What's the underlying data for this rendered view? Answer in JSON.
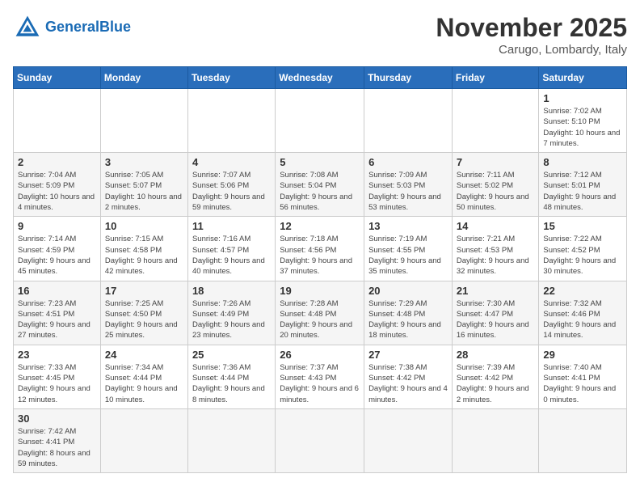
{
  "logo": {
    "text_general": "General",
    "text_blue": "Blue"
  },
  "title": "November 2025",
  "location": "Carugo, Lombardy, Italy",
  "weekdays": [
    "Sunday",
    "Monday",
    "Tuesday",
    "Wednesday",
    "Thursday",
    "Friday",
    "Saturday"
  ],
  "weeks": [
    [
      {
        "day": "",
        "info": ""
      },
      {
        "day": "",
        "info": ""
      },
      {
        "day": "",
        "info": ""
      },
      {
        "day": "",
        "info": ""
      },
      {
        "day": "",
        "info": ""
      },
      {
        "day": "",
        "info": ""
      },
      {
        "day": "1",
        "info": "Sunrise: 7:02 AM\nSunset: 5:10 PM\nDaylight: 10 hours and 7 minutes."
      }
    ],
    [
      {
        "day": "2",
        "info": "Sunrise: 7:04 AM\nSunset: 5:09 PM\nDaylight: 10 hours and 4 minutes."
      },
      {
        "day": "3",
        "info": "Sunrise: 7:05 AM\nSunset: 5:07 PM\nDaylight: 10 hours and 2 minutes."
      },
      {
        "day": "4",
        "info": "Sunrise: 7:07 AM\nSunset: 5:06 PM\nDaylight: 9 hours and 59 minutes."
      },
      {
        "day": "5",
        "info": "Sunrise: 7:08 AM\nSunset: 5:04 PM\nDaylight: 9 hours and 56 minutes."
      },
      {
        "day": "6",
        "info": "Sunrise: 7:09 AM\nSunset: 5:03 PM\nDaylight: 9 hours and 53 minutes."
      },
      {
        "day": "7",
        "info": "Sunrise: 7:11 AM\nSunset: 5:02 PM\nDaylight: 9 hours and 50 minutes."
      },
      {
        "day": "8",
        "info": "Sunrise: 7:12 AM\nSunset: 5:01 PM\nDaylight: 9 hours and 48 minutes."
      }
    ],
    [
      {
        "day": "9",
        "info": "Sunrise: 7:14 AM\nSunset: 4:59 PM\nDaylight: 9 hours and 45 minutes."
      },
      {
        "day": "10",
        "info": "Sunrise: 7:15 AM\nSunset: 4:58 PM\nDaylight: 9 hours and 42 minutes."
      },
      {
        "day": "11",
        "info": "Sunrise: 7:16 AM\nSunset: 4:57 PM\nDaylight: 9 hours and 40 minutes."
      },
      {
        "day": "12",
        "info": "Sunrise: 7:18 AM\nSunset: 4:56 PM\nDaylight: 9 hours and 37 minutes."
      },
      {
        "day": "13",
        "info": "Sunrise: 7:19 AM\nSunset: 4:55 PM\nDaylight: 9 hours and 35 minutes."
      },
      {
        "day": "14",
        "info": "Sunrise: 7:21 AM\nSunset: 4:53 PM\nDaylight: 9 hours and 32 minutes."
      },
      {
        "day": "15",
        "info": "Sunrise: 7:22 AM\nSunset: 4:52 PM\nDaylight: 9 hours and 30 minutes."
      }
    ],
    [
      {
        "day": "16",
        "info": "Sunrise: 7:23 AM\nSunset: 4:51 PM\nDaylight: 9 hours and 27 minutes."
      },
      {
        "day": "17",
        "info": "Sunrise: 7:25 AM\nSunset: 4:50 PM\nDaylight: 9 hours and 25 minutes."
      },
      {
        "day": "18",
        "info": "Sunrise: 7:26 AM\nSunset: 4:49 PM\nDaylight: 9 hours and 23 minutes."
      },
      {
        "day": "19",
        "info": "Sunrise: 7:28 AM\nSunset: 4:48 PM\nDaylight: 9 hours and 20 minutes."
      },
      {
        "day": "20",
        "info": "Sunrise: 7:29 AM\nSunset: 4:48 PM\nDaylight: 9 hours and 18 minutes."
      },
      {
        "day": "21",
        "info": "Sunrise: 7:30 AM\nSunset: 4:47 PM\nDaylight: 9 hours and 16 minutes."
      },
      {
        "day": "22",
        "info": "Sunrise: 7:32 AM\nSunset: 4:46 PM\nDaylight: 9 hours and 14 minutes."
      }
    ],
    [
      {
        "day": "23",
        "info": "Sunrise: 7:33 AM\nSunset: 4:45 PM\nDaylight: 9 hours and 12 minutes."
      },
      {
        "day": "24",
        "info": "Sunrise: 7:34 AM\nSunset: 4:44 PM\nDaylight: 9 hours and 10 minutes."
      },
      {
        "day": "25",
        "info": "Sunrise: 7:36 AM\nSunset: 4:44 PM\nDaylight: 9 hours and 8 minutes."
      },
      {
        "day": "26",
        "info": "Sunrise: 7:37 AM\nSunset: 4:43 PM\nDaylight: 9 hours and 6 minutes."
      },
      {
        "day": "27",
        "info": "Sunrise: 7:38 AM\nSunset: 4:42 PM\nDaylight: 9 hours and 4 minutes."
      },
      {
        "day": "28",
        "info": "Sunrise: 7:39 AM\nSunset: 4:42 PM\nDaylight: 9 hours and 2 minutes."
      },
      {
        "day": "29",
        "info": "Sunrise: 7:40 AM\nSunset: 4:41 PM\nDaylight: 9 hours and 0 minutes."
      }
    ],
    [
      {
        "day": "30",
        "info": "Sunrise: 7:42 AM\nSunset: 4:41 PM\nDaylight: 8 hours and 59 minutes."
      },
      {
        "day": "",
        "info": ""
      },
      {
        "day": "",
        "info": ""
      },
      {
        "day": "",
        "info": ""
      },
      {
        "day": "",
        "info": ""
      },
      {
        "day": "",
        "info": ""
      },
      {
        "day": "",
        "info": ""
      }
    ]
  ]
}
